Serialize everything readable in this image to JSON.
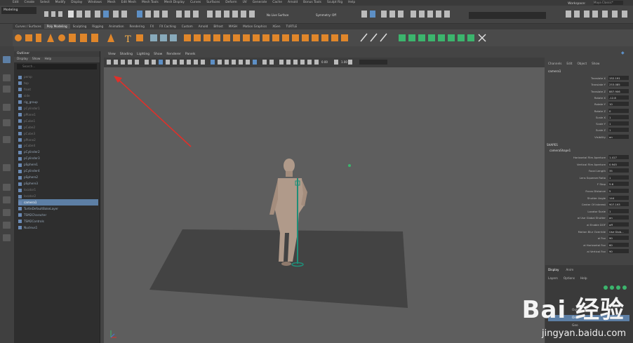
{
  "menubar": {
    "items": [
      "Edit",
      "Create",
      "Select",
      "Modify",
      "Display",
      "Windows",
      "Mesh",
      "Edit Mesh",
      "Mesh Tools",
      "Mesh Display",
      "Curves",
      "Surfaces",
      "Deform",
      "UV",
      "Generate",
      "Cache",
      "Arnold",
      "Bonus Tools",
      "Sculpt Rig",
      "Help"
    ],
    "workspace_label": "Workspace:",
    "workspace_value": "Maya Classic*"
  },
  "status_line": {
    "mode": "Modeling",
    "live_surface": "No Live Surface",
    "symmetry": "Symmetry: Off"
  },
  "shelf": {
    "tabs": [
      "Curves / Surfaces",
      "Poly Modeling",
      "Sculpting",
      "Rigging",
      "Animation",
      "Rendering",
      "FX",
      "FX Caching",
      "Custom",
      "Arnold",
      "Bifrost",
      "MASH",
      "Motion Graphics",
      "XGen",
      "TURTLE"
    ],
    "active_tab": "Poly Modeling"
  },
  "outliner": {
    "title": "Outliner",
    "menu": [
      "Display",
      "Show",
      "Help"
    ],
    "search_placeholder": "Search...",
    "rows": [
      {
        "label": "persp",
        "dim": true
      },
      {
        "label": "top",
        "dim": true
      },
      {
        "label": "front",
        "dim": true
      },
      {
        "label": "side",
        "dim": true
      },
      {
        "label": "rig_group",
        "dim": false
      },
      {
        "label": "pCylinder1",
        "dim": true
      },
      {
        "label": "pPlane1",
        "dim": true
      },
      {
        "label": "pCube1",
        "dim": true
      },
      {
        "label": "pCube2",
        "dim": true
      },
      {
        "label": "pCube3",
        "dim": true
      },
      {
        "label": "pPlane2",
        "dim": true
      },
      {
        "label": "pCube4",
        "dim": true
      },
      {
        "label": "pCylinder2",
        "dim": false
      },
      {
        "label": "pCylinder3",
        "dim": false
      },
      {
        "label": "pSphere1",
        "dim": false
      },
      {
        "label": "pCylinder4",
        "dim": false
      },
      {
        "label": "pSphere2",
        "dim": false
      },
      {
        "label": "pSphere3",
        "dim": false
      },
      {
        "label": "locator1",
        "dim": true
      },
      {
        "label": "locator2",
        "dim": true
      },
      {
        "label": "camera1",
        "dim": false,
        "selected": true
      },
      {
        "label": "TurtleDefaultBakeLayer",
        "dim": false
      },
      {
        "label": "TSM2Character",
        "dim": false
      },
      {
        "label": "TSM2Controls",
        "dim": false
      },
      {
        "label": "Nucleus1",
        "dim": false
      }
    ]
  },
  "viewport": {
    "menu": [
      "View",
      "Shading",
      "Lighting",
      "Show",
      "Renderer",
      "Panels"
    ],
    "value_a": "0.00",
    "value_b": "1.00"
  },
  "channel_box": {
    "menu": [
      "Channels",
      "Edit",
      "Object",
      "Show"
    ],
    "object_name": "camera1",
    "transform": [
      {
        "label": "Translate X",
        "value": "152.191"
      },
      {
        "label": "Translate Y",
        "value": "253.085"
      },
      {
        "label": "Translate Z",
        "value": "887.906"
      },
      {
        "label": "Rotate X",
        "value": "-12.8"
      },
      {
        "label": "Rotate Y",
        "value": "10"
      },
      {
        "label": "Rotate Z",
        "value": "0"
      },
      {
        "label": "Scale X",
        "value": "1"
      },
      {
        "label": "Scale Y",
        "value": "1"
      },
      {
        "label": "Scale Z",
        "value": "1"
      },
      {
        "label": "Visibility",
        "value": "on"
      }
    ],
    "shapes_header": "SHAPES",
    "shape_name": "cameraShape1",
    "shape_attrs": [
      {
        "label": "Horizontal Film Aperture",
        "value": "1.417"
      },
      {
        "label": "Vertical Film Aperture",
        "value": "0.945"
      },
      {
        "label": "Focal Length",
        "value": "35"
      },
      {
        "label": "Lens Squeeze Ratio",
        "value": "1"
      },
      {
        "label": "F Stop",
        "value": "5.6"
      },
      {
        "label": "Focus Distance",
        "value": "5"
      },
      {
        "label": "Shutter Angle",
        "value": "144"
      },
      {
        "label": "Center Of Interest",
        "value": "907.193"
      },
      {
        "label": "Locator Scale",
        "value": "1"
      },
      {
        "label": "ai Use Global Shutter",
        "value": "on"
      },
      {
        "label": "ai Enable DOF",
        "value": "off"
      },
      {
        "label": "Motion Blur Override",
        "value": "Use Glob..."
      },
      {
        "label": "ai Fov",
        "value": "90"
      },
      {
        "label": "ai Horizontal Fov",
        "value": "60"
      },
      {
        "label": "ai Vertical Fov",
        "value": "90"
      }
    ]
  },
  "layer_editor": {
    "tabs": [
      "Display",
      "Anim"
    ],
    "menu": [
      "Layers",
      "Options",
      "Help"
    ],
    "layers": [
      {
        "label": "Outline",
        "selected": false
      },
      {
        "label": "One",
        "selected": true
      },
      {
        "label": "Geo",
        "selected": false
      }
    ]
  },
  "watermark": {
    "brand": "Bai 经验",
    "url": "jingyan.baidu.com"
  },
  "colors": {
    "viewport_bg": "#5e5e5e",
    "ground": "#424242",
    "figure": "#b09a8a",
    "rig": "#1f8e78",
    "selection": "#5d7fa5",
    "arrow": "#e0302a"
  }
}
